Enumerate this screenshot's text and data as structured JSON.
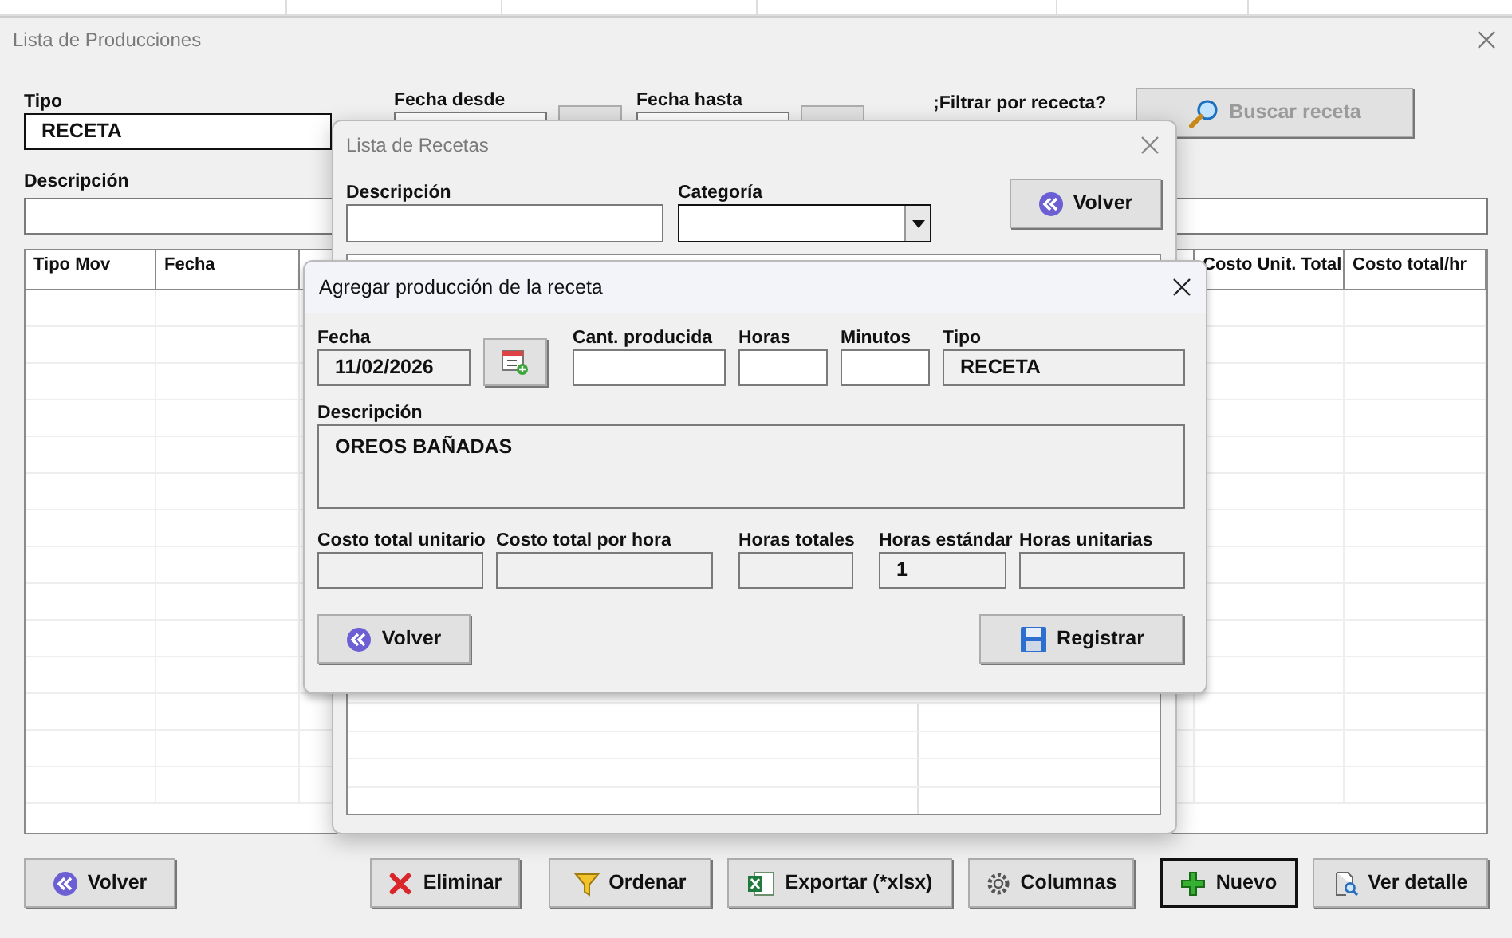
{
  "main_window": {
    "title": "Lista de Producciones",
    "tipo": {
      "label": "Tipo",
      "value": "RECETA"
    },
    "fecha_desde": {
      "label": "Fecha desde"
    },
    "fecha_hasta": {
      "label": "Fecha hasta"
    },
    "filter_question": ";Filtrar por rececta?",
    "search_button": {
      "label": "Buscar receta",
      "disabled": true
    },
    "descripcion": {
      "label": "Descripción"
    },
    "table": {
      "columns": [
        "Tipo Mov",
        "Fecha",
        "Costo Unit. Total",
        "Costo total/hr"
      ]
    },
    "buttons": [
      {
        "label": "Volver",
        "kind": "back",
        "default": false
      },
      {
        "label": "Eliminar",
        "kind": "delete",
        "default": false
      },
      {
        "label": "Ordenar",
        "kind": "sort",
        "default": false
      },
      {
        "label": "Exportar (*xlsx)",
        "kind": "export",
        "default": false
      },
      {
        "label": "Columnas",
        "kind": "columns",
        "default": false
      },
      {
        "label": "Nuevo",
        "kind": "new",
        "default": true
      },
      {
        "label": "Ver detalle",
        "kind": "detail",
        "default": false
      }
    ]
  },
  "recipes_window": {
    "title": "Lista de Recetas",
    "descripcion": {
      "label": "Descripción"
    },
    "categoria": {
      "label": "Categoría"
    },
    "back_button": {
      "label": "Volver",
      "kind": "back"
    }
  },
  "dialog": {
    "title": "Agregar producción de la receta",
    "fecha": {
      "label": "Fecha",
      "value": "11/02/2026"
    },
    "cantidad": {
      "label": "Cant. producida"
    },
    "horas": {
      "label": "Horas"
    },
    "minutos": {
      "label": "Minutos"
    },
    "tipo": {
      "label": "Tipo",
      "value": "RECETA"
    },
    "descripcion": {
      "label": "Descripción",
      "value": "OREOS BAÑADAS"
    },
    "costo_total_unitario": {
      "label": "Costo total unitario"
    },
    "costo_total_hora": {
      "label": "Costo total por hora"
    },
    "horas_totales": {
      "label": "Horas totales"
    },
    "horas_estandar": {
      "label": "Horas estándar",
      "value": "1"
    },
    "horas_unitarias": {
      "label": "Horas unitarias"
    },
    "back_button": {
      "label": "Volver",
      "kind": "back"
    },
    "register_button": {
      "label": "Registrar",
      "kind": "save"
    }
  }
}
